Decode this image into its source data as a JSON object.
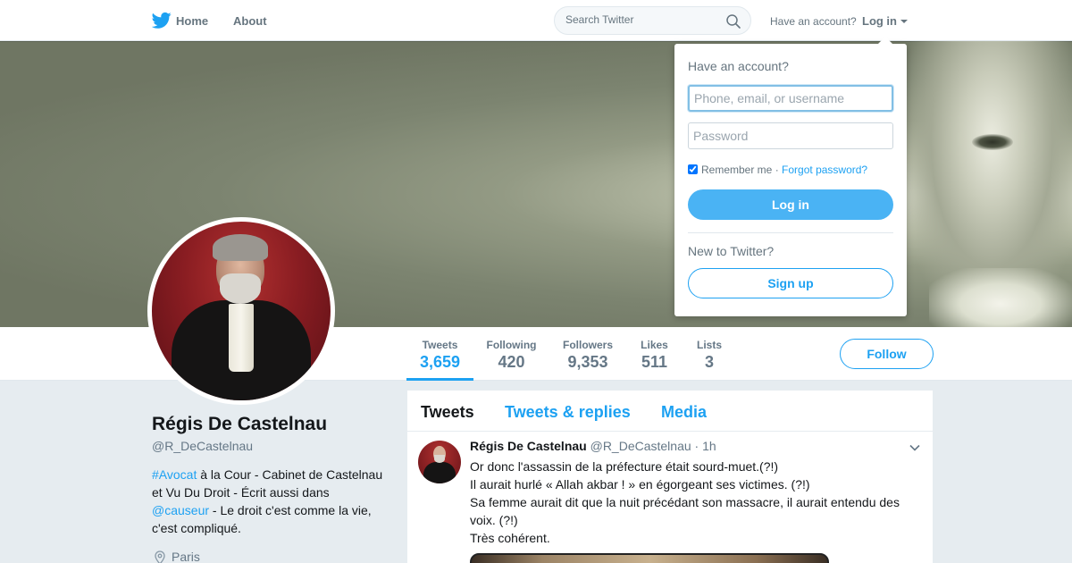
{
  "nav": {
    "home_label": "Home",
    "about_label": "About",
    "search_placeholder": "Search Twitter",
    "have_account": "Have an account?",
    "login_label": "Log in"
  },
  "profile_nav": {
    "stats": [
      {
        "label": "Tweets",
        "value": "3,659",
        "active": true
      },
      {
        "label": "Following",
        "value": "420"
      },
      {
        "label": "Followers",
        "value": "9,353"
      },
      {
        "label": "Likes",
        "value": "511"
      },
      {
        "label": "Lists",
        "value": "3"
      }
    ],
    "follow_label": "Follow"
  },
  "profile": {
    "name": "Régis De Castelnau",
    "handle": "@R_DeCastelnau",
    "bio_hashtag": "#Avocat",
    "bio_part1": " à la Cour - Cabinet de Castelnau et Vu Du Droit - Écrit aussi dans ",
    "bio_mention": "@causeur",
    "bio_part2": " - Le droit c'est comme la vie, c'est compliqué.",
    "location": "Paris"
  },
  "timeline": {
    "tabs": [
      {
        "label": "Tweets",
        "active": true
      },
      {
        "label": "Tweets & replies"
      },
      {
        "label": "Media"
      }
    ],
    "tweet": {
      "name": "Régis De Castelnau",
      "handle": "@R_DeCastelnau",
      "dot": "·",
      "time": "1h",
      "lines": [
        "Or donc l'assassin de la préfecture était sourd-muet.(?!)",
        "Il aurait hurlé « Allah akbar ! » en égorgeant ses victimes. (?!)",
        "Sa femme aurait dit que la nuit précédant son massacre, il aurait entendu des voix. (?!)",
        "Très cohérent."
      ]
    }
  },
  "login_dropdown": {
    "title": "Have an account?",
    "username_placeholder": "Phone, email, or username",
    "password_placeholder": "Password",
    "remember_label": "Remember me",
    "separator": "·",
    "forgot_label": "Forgot password?",
    "login_button": "Log in",
    "new_label": "New to Twitter?",
    "signup_button": "Sign up"
  },
  "colors": {
    "accent": "#1da1f2",
    "login_button": "#4ab3f4",
    "page_bg": "#e6ecf0",
    "muted_text": "#657786"
  },
  "icons": [
    "twitter-bird-icon",
    "search-icon",
    "caret-down-icon",
    "location-pin-icon",
    "chevron-down-icon"
  ]
}
